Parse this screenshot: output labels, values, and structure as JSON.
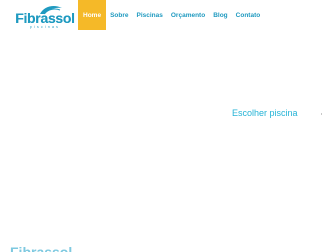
{
  "brand": {
    "name": "Fibrassol",
    "sub": "piscinas"
  },
  "nav": {
    "items": [
      {
        "label": "Home",
        "active": true
      },
      {
        "label": "Sobre"
      },
      {
        "label": "Piscinas"
      },
      {
        "label": "Orçamento"
      },
      {
        "label": "Blog"
      },
      {
        "label": "Contato"
      }
    ]
  },
  "main": {
    "cta_text": "Escolher piscina"
  },
  "colors": {
    "brand_blue": "#1f9ac0",
    "accent_yellow": "#f5b928",
    "cta_cyan": "#24b3d6"
  }
}
